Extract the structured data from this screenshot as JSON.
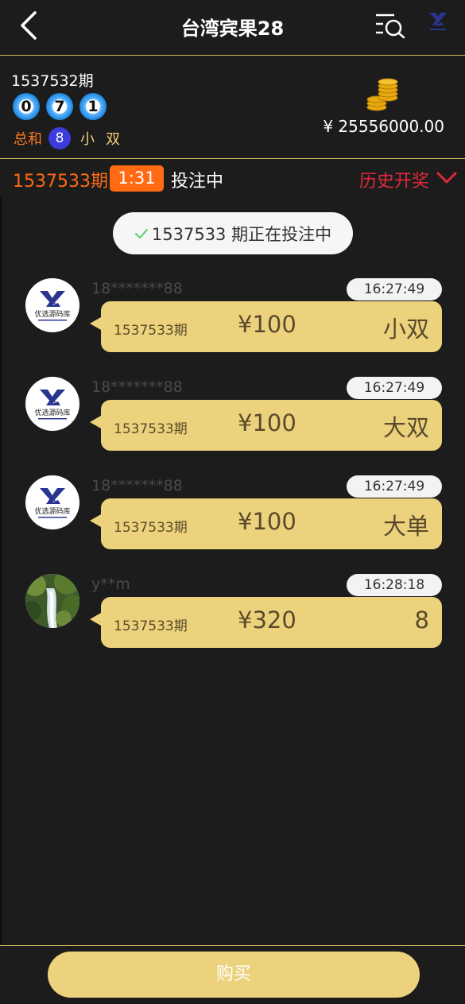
{
  "header": {
    "title": "台湾宾果28"
  },
  "last_result": {
    "period": "1537532期",
    "balls": [
      "0",
      "7",
      "1"
    ],
    "sum_label": "总和",
    "sum_value": "8",
    "size": "小",
    "parity": "双",
    "balance": "¥ 25556000.00"
  },
  "current": {
    "period": "1537533期",
    "countdown": "1:31",
    "status": "投注中",
    "history_label": "历史开奖"
  },
  "notice": "1537533 期正在投注中",
  "messages": [
    {
      "user": "18*******88",
      "time": "16:27:49",
      "period": "1537533期",
      "amount": "¥100",
      "choice": "小双",
      "avatar": "logo"
    },
    {
      "user": "18*******88",
      "time": "16:27:49",
      "period": "1537533期",
      "amount": "¥100",
      "choice": "大双",
      "avatar": "logo"
    },
    {
      "user": "18*******88",
      "time": "16:27:49",
      "period": "1537533期",
      "amount": "¥100",
      "choice": "大单",
      "avatar": "logo"
    },
    {
      "user": "y**m",
      "time": "16:28:18",
      "period": "1537533期",
      "amount": "¥320",
      "choice": "8",
      "avatar": "waterfall-photo"
    }
  ],
  "avatar_logo_text": "优选源码库",
  "footer": {
    "buy_label": "购买"
  },
  "colors": {
    "accent_orange": "#ff6a13",
    "gold": "#ecd27c",
    "history_red": "#e0283c",
    "background": "#1c1c1c"
  }
}
